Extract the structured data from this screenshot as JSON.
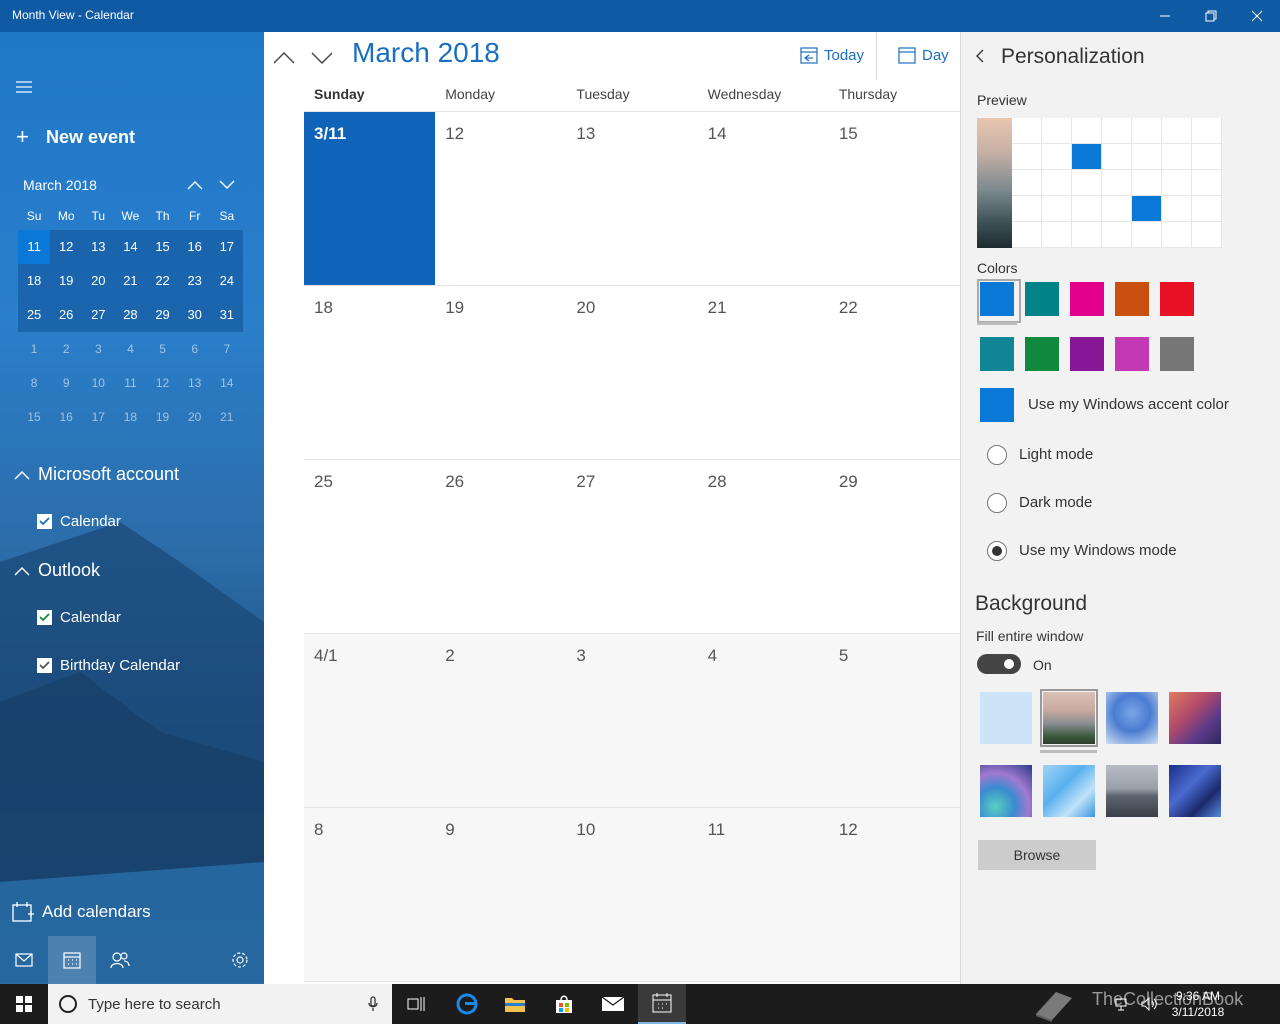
{
  "window": {
    "title": "Month View - Calendar"
  },
  "sidebar": {
    "new_event": "New event",
    "mini_calendar": {
      "title": "March 2018",
      "weekdays": [
        "Su",
        "Mo",
        "Tu",
        "We",
        "Th",
        "Fr",
        "Sa"
      ],
      "weeks": [
        [
          "11",
          "12",
          "13",
          "14",
          "15",
          "16",
          "17"
        ],
        [
          "18",
          "19",
          "20",
          "21",
          "22",
          "23",
          "24"
        ],
        [
          "25",
          "26",
          "27",
          "28",
          "29",
          "30",
          "31"
        ],
        [
          "1",
          "2",
          "3",
          "4",
          "5",
          "6",
          "7"
        ],
        [
          "8",
          "9",
          "10",
          "11",
          "12",
          "13",
          "14"
        ],
        [
          "15",
          "16",
          "17",
          "18",
          "19",
          "20",
          "21"
        ]
      ],
      "selected_day": "11"
    },
    "accounts": [
      {
        "name": "Microsoft account",
        "calendars": [
          "Calendar"
        ]
      },
      {
        "name": "Outlook",
        "calendars": [
          "Calendar",
          "Birthday Calendar"
        ]
      }
    ],
    "add_calendars": "Add calendars",
    "bottom_icons": [
      "mail-icon",
      "calendar-icon",
      "people-icon",
      "settings-icon"
    ]
  },
  "main": {
    "month_title": "March 2018",
    "today_label": "Today",
    "view_label": "Day",
    "weekdays": [
      "Sunday",
      "Monday",
      "Tuesday",
      "Wednesday",
      "Thursday"
    ],
    "weeks": [
      [
        "3/11",
        "12",
        "13",
        "14",
        "15"
      ],
      [
        "18",
        "19",
        "20",
        "21",
        "22"
      ],
      [
        "25",
        "26",
        "27",
        "28",
        "29"
      ],
      [
        "4/1",
        "2",
        "3",
        "4",
        "5"
      ],
      [
        "8",
        "9",
        "10",
        "11",
        "12"
      ]
    ],
    "selected_cell": "3/11",
    "accent_color": "#0f63b8"
  },
  "personalization": {
    "title": "Personalization",
    "preview_label": "Preview",
    "colors_label": "Colors",
    "colors": [
      "#0a78d7",
      "#038387",
      "#e3008c",
      "#ca5010",
      "#e81123",
      "#0f8596",
      "#10893e",
      "#881798",
      "#c239b3",
      "#767676"
    ],
    "selected_color": "#0a78d7",
    "accent_option": "Use my Windows accent color",
    "accent_swatch": "#0a78d7",
    "modes": [
      "Light mode",
      "Dark mode",
      "Use my Windows mode"
    ],
    "selected_mode": "Use my Windows mode",
    "background_title": "Background",
    "fill_label": "Fill entire window",
    "toggle_state": "On",
    "browse": "Browse"
  },
  "taskbar": {
    "search_placeholder": "Type here to search",
    "time": "9:36 AM",
    "date": "3/11/2018",
    "watermark": "TheCollectionBook"
  }
}
